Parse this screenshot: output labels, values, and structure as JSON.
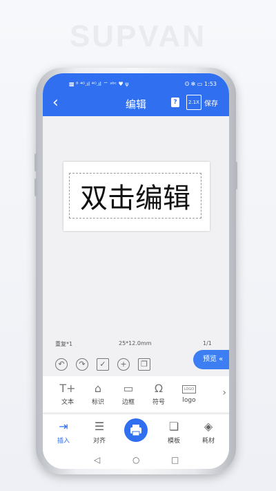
{
  "brand": "SUPVAN",
  "status_bar": {
    "left_icons": "▩ ᴮ ⁴ᴳ.ıl ⁴ᴳ.ıl ⌔ ᵃᵇᶜ ♥ ψ",
    "right_text": "ʘ ✻ ▭ 1:53"
  },
  "header": {
    "back": "‹",
    "title": "编辑",
    "help": "?",
    "zoom": "2.1X",
    "save": "保存"
  },
  "label_canvas": {
    "text": "双击编辑"
  },
  "meta": {
    "repeat": "重复*1",
    "size": "25*12.0mm",
    "page": "1/1"
  },
  "preview_button": "预览 «",
  "insert_items": [
    {
      "label": "文本"
    },
    {
      "label": "标识"
    },
    {
      "label": "边框"
    },
    {
      "label": "符号"
    },
    {
      "label": "logo"
    }
  ],
  "tabs": [
    {
      "label": "插入"
    },
    {
      "label": "对齐"
    },
    {
      "label": "模板"
    },
    {
      "label": "耗材"
    }
  ],
  "colors": {
    "accent": "#2f6ff0",
    "preview": "#3d7ff2"
  }
}
